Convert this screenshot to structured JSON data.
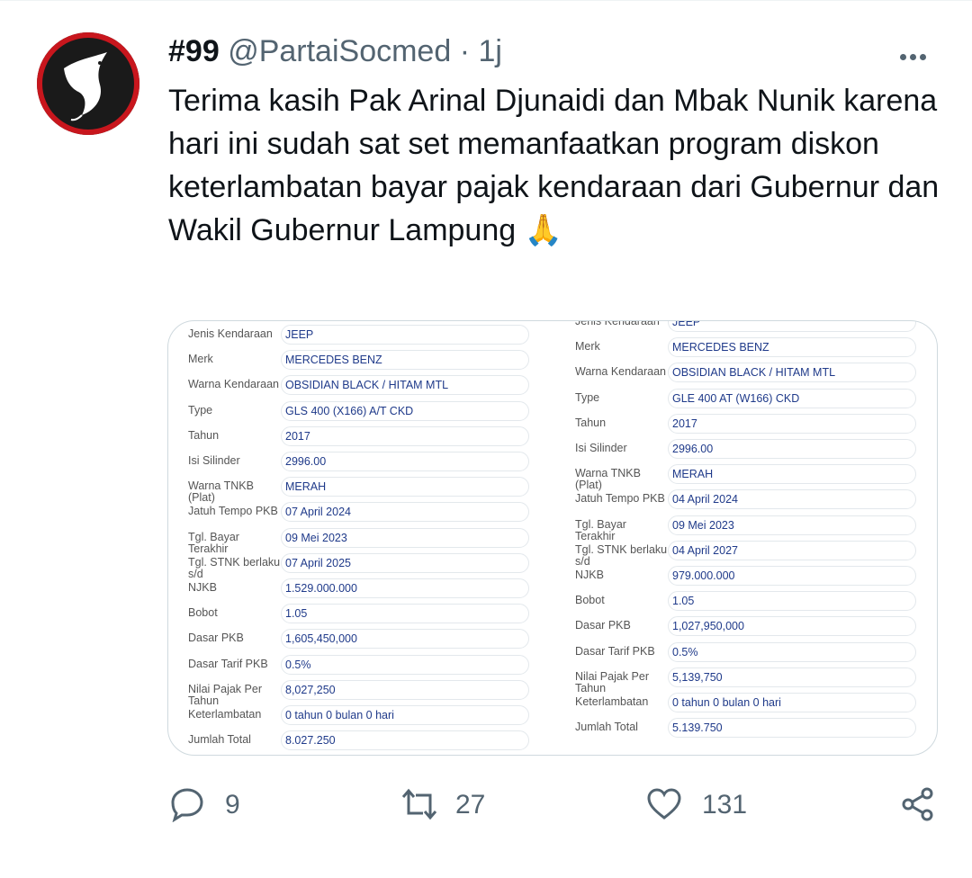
{
  "tweet": {
    "rank": "#99",
    "handle": "@PartaiSocmed",
    "separator": "·",
    "time": "1j",
    "text": "Terima kasih Pak Arinal Djunaidi dan Mbak Nunik karena hari ini sudah sat set memanfaatkan program diskon keterlambatan bayar pajak kendaraan dari Gubernur dan Wakil Gubernur Lampung 🙏"
  },
  "icons": {
    "avatar": "partai-socmed-logo",
    "more": "more-horizontal-icon",
    "reply": "reply-icon",
    "retweet": "retweet-icon",
    "like": "heart-icon",
    "share": "share-icon"
  },
  "colors": {
    "accent": "#536471",
    "avatar_ring": "#c8161d",
    "field_text": "#1f3a8a"
  },
  "media": {
    "left": [
      {
        "label": "Jenis Kendaraan",
        "value": "JEEP"
      },
      {
        "label": "Merk",
        "value": "MERCEDES BENZ"
      },
      {
        "label": "Warna Kendaraan",
        "value": "OBSIDIAN BLACK / HITAM MTL"
      },
      {
        "label": "Type",
        "value": "GLS 400 (X166) A/T CKD"
      },
      {
        "label": "Tahun",
        "value": "2017"
      },
      {
        "label": "Isi Silinder",
        "value": "2996.00"
      },
      {
        "label": "Warna TNKB (Plat)",
        "value": "MERAH"
      },
      {
        "label": "Jatuh Tempo PKB",
        "value": "07 April 2024"
      },
      {
        "label": "Tgl. Bayar Terakhir",
        "value": "09 Mei 2023"
      },
      {
        "label": "Tgl. STNK berlaku s/d",
        "value": "07 April 2025"
      },
      {
        "label": "NJKB",
        "value": "1.529.000.000"
      },
      {
        "label": "Bobot",
        "value": "1.05"
      },
      {
        "label": "Dasar PKB",
        "value": "1,605,450,000"
      },
      {
        "label": "Dasar Tarif PKB",
        "value": "0.5%"
      },
      {
        "label": "Nilai Pajak Per Tahun",
        "value": "8,027,250"
      },
      {
        "label": "Keterlambatan",
        "value": "0 tahun 0 bulan 0 hari"
      },
      {
        "label": "Jumlah Total",
        "value": "8.027.250"
      }
    ],
    "right": [
      {
        "label": "Jenis Kendaraan",
        "value": "JEEP"
      },
      {
        "label": "Merk",
        "value": "MERCEDES BENZ"
      },
      {
        "label": "Warna Kendaraan",
        "value": "OBSIDIAN BLACK / HITAM MTL"
      },
      {
        "label": "Type",
        "value": "GLE 400 AT (W166) CKD"
      },
      {
        "label": "Tahun",
        "value": "2017"
      },
      {
        "label": "Isi Silinder",
        "value": "2996.00"
      },
      {
        "label": "Warna TNKB (Plat)",
        "value": "MERAH"
      },
      {
        "label": "Jatuh Tempo PKB",
        "value": "04 April 2024"
      },
      {
        "label": "Tgl. Bayar Terakhir",
        "value": "09 Mei 2023"
      },
      {
        "label": "Tgl. STNK berlaku s/d",
        "value": "04 April 2027"
      },
      {
        "label": "NJKB",
        "value": "979.000.000"
      },
      {
        "label": "Bobot",
        "value": "1.05"
      },
      {
        "label": "Dasar PKB",
        "value": "1,027,950,000"
      },
      {
        "label": "Dasar Tarif PKB",
        "value": "0.5%"
      },
      {
        "label": "Nilai Pajak Per Tahun",
        "value": "5,139,750"
      },
      {
        "label": "Keterlambatan",
        "value": "0 tahun 0 bulan 0 hari"
      },
      {
        "label": "Jumlah Total",
        "value": "5.139.750"
      }
    ]
  },
  "actions": {
    "replies": "9",
    "retweets": "27",
    "likes": "131"
  }
}
